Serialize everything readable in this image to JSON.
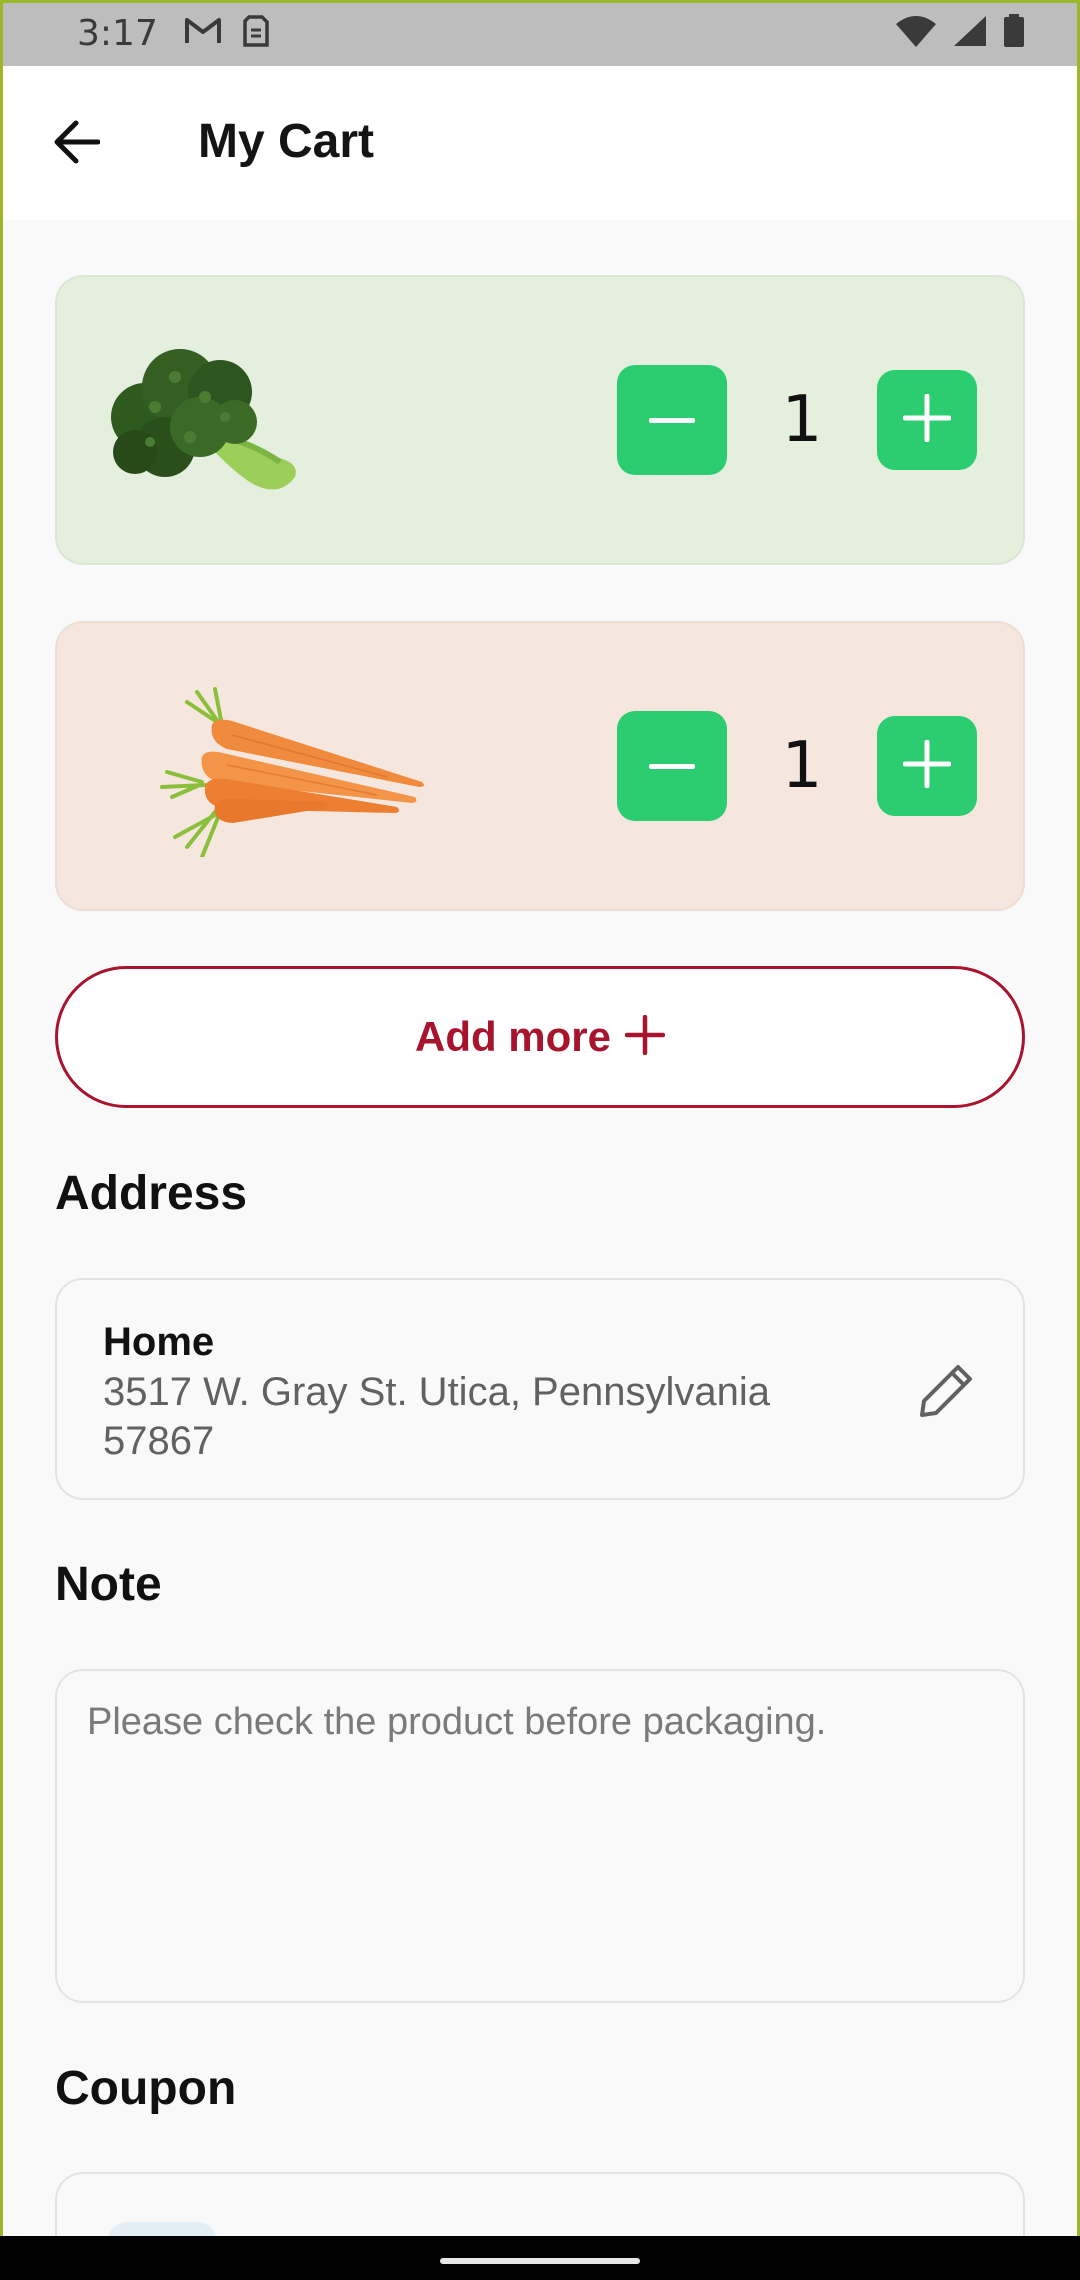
{
  "status_bar": {
    "time": "3:17",
    "icons_left": [
      "gmail-icon",
      "sim-icon"
    ],
    "icons_right": [
      "wifi-icon",
      "signal-icon",
      "battery-icon"
    ]
  },
  "header": {
    "title": "My Cart",
    "back_icon": "arrow-left-icon"
  },
  "cart": {
    "items": [
      {
        "name": "broccoli",
        "quantity": "1",
        "background": "#e4efdd"
      },
      {
        "name": "carrots",
        "quantity": "1",
        "background": "#f6e7de"
      }
    ],
    "add_more_label": "Add more"
  },
  "address": {
    "section_title": "Address",
    "label": "Home",
    "line": "3517 W. Gray St. Utica, Pennsylvania 57867",
    "edit_icon": "pencil-icon"
  },
  "note": {
    "section_title": "Note",
    "placeholder": "Please check the product before packaging.",
    "value": ""
  },
  "coupon": {
    "section_title": "Coupon"
  },
  "colors": {
    "accent_green": "#2ccc71",
    "accent_red": "#a8142e",
    "background": "#f9f9f9"
  }
}
